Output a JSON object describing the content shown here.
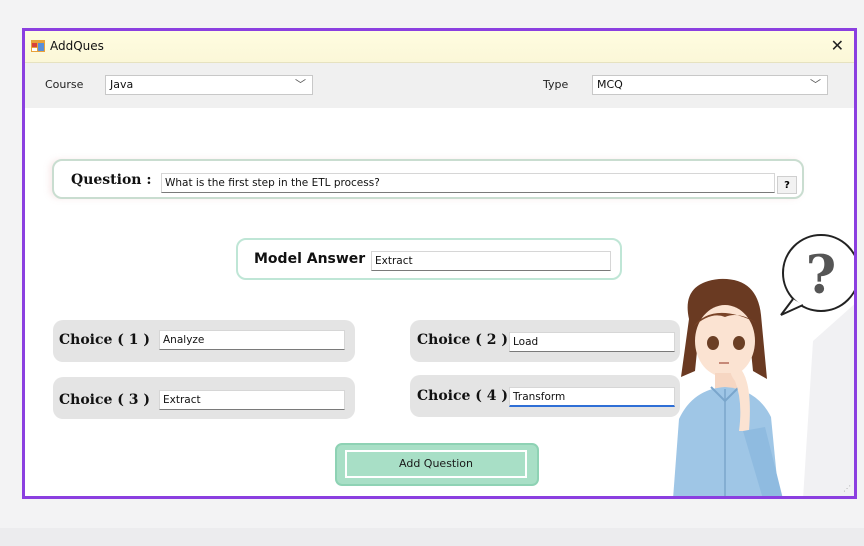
{
  "window": {
    "title": "AddQues",
    "close_glyph": "✕"
  },
  "toolbar": {
    "course_label": "Course",
    "course_value": "Java",
    "type_label": "Type",
    "type_value": "MCQ",
    "chevron": "﹀"
  },
  "question": {
    "label": "Question :",
    "value": "What is the first step in the ETL process?",
    "help_label": "?"
  },
  "model_answer": {
    "label": "Model Answer",
    "value": "Extract"
  },
  "choices": [
    {
      "label": "Choice ( 1 )",
      "value": "Analyze"
    },
    {
      "label": "Choice ( 2 )",
      "value": "Load"
    },
    {
      "label": "Choice ( 3 )",
      "value": "Extract"
    },
    {
      "label": "Choice ( 4 )",
      "value": "Transform"
    }
  ],
  "add_button": {
    "label": "Add Question"
  },
  "colors": {
    "window_border": "#8b3fe0",
    "button": "#a8dfc6",
    "focus": "#2f6fd6"
  },
  "icons": [
    "app-form-icon",
    "close-icon",
    "chevron-down-icon",
    "thinking-girl-illustration",
    "question-bubble-icon",
    "resize-grip-icon"
  ]
}
